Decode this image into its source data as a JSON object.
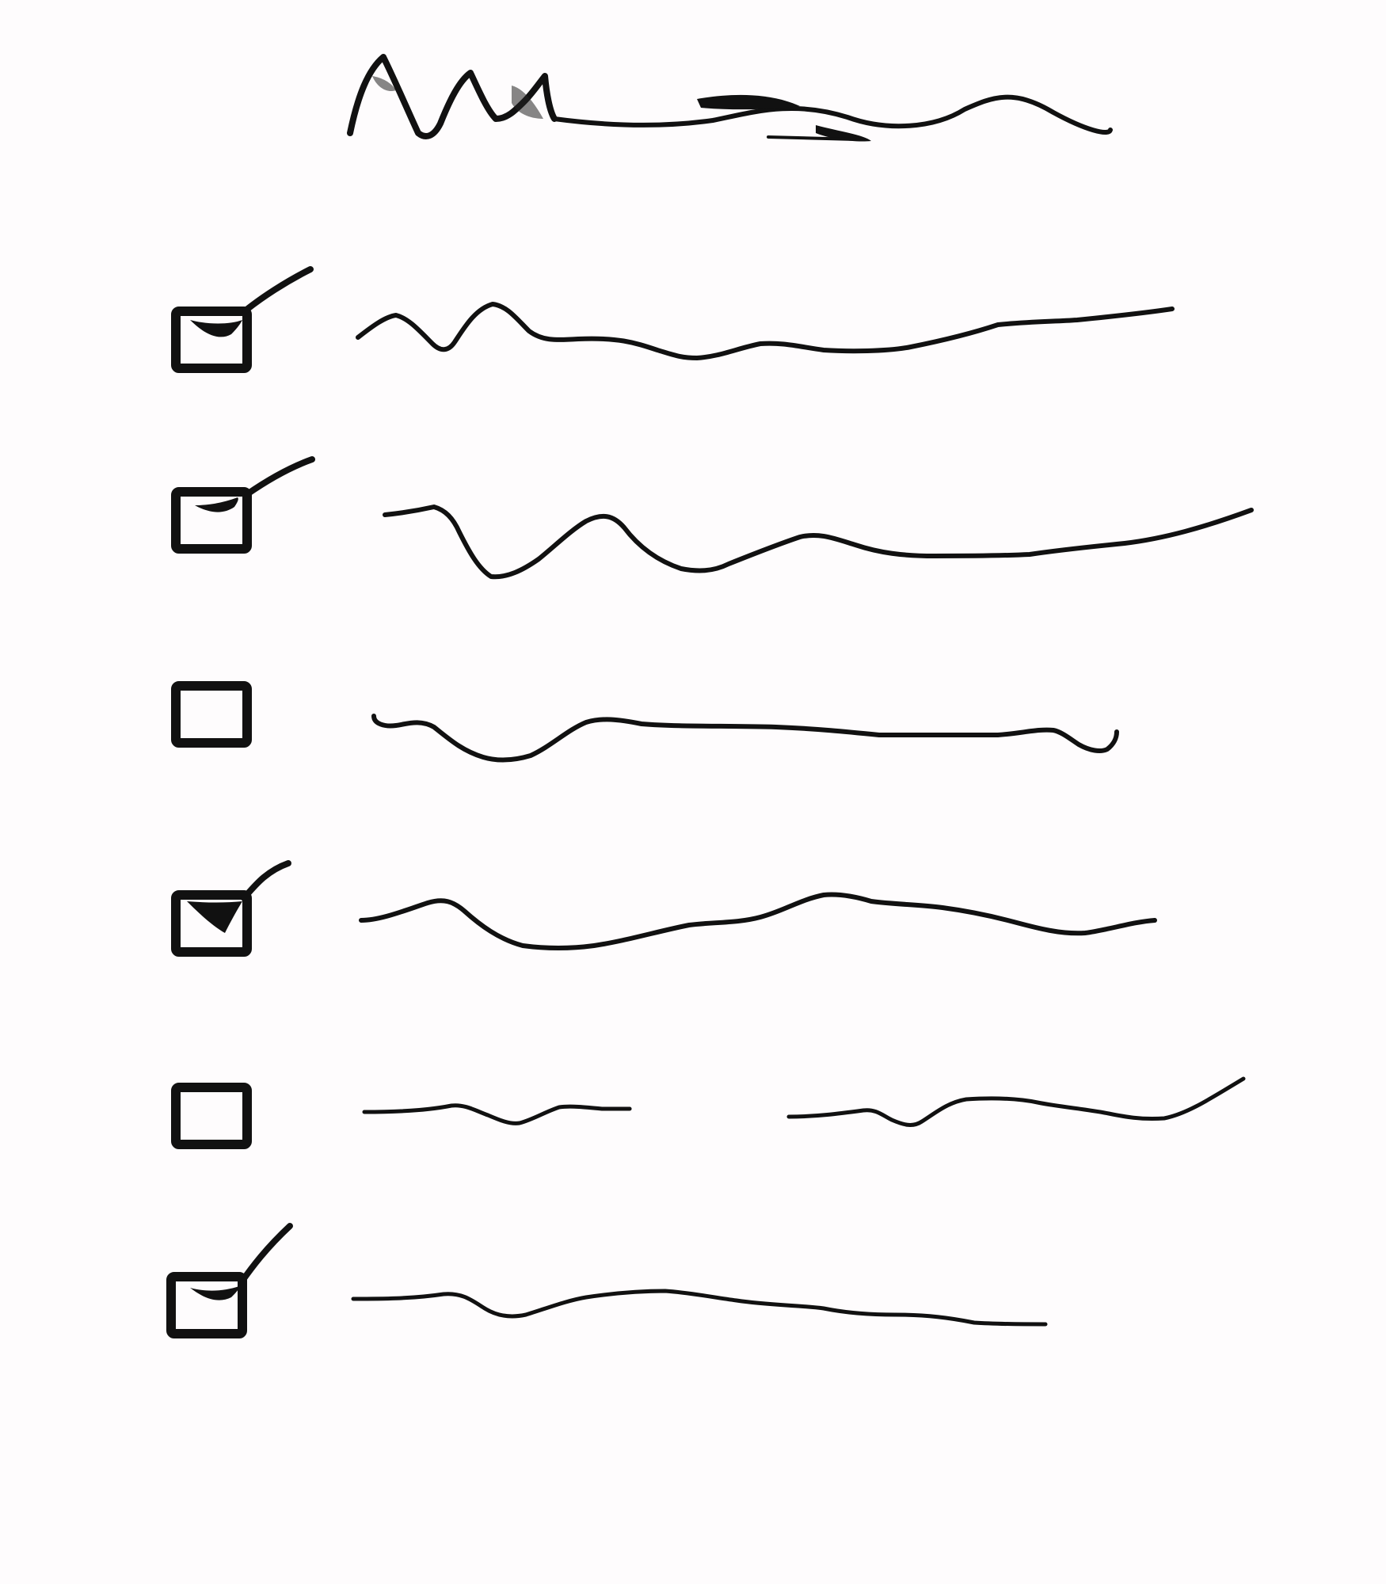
{
  "sketch": {
    "heading_scribble": "title-scribble",
    "items": [
      {
        "checked": true
      },
      {
        "checked": true
      },
      {
        "checked": false
      },
      {
        "checked": true
      },
      {
        "checked": false
      },
      {
        "checked": true
      }
    ],
    "colors": {
      "paper": "#fefcfd",
      "ink": "#111111"
    },
    "icons": {
      "checkbox": "hand-drawn-checkbox-icon",
      "check": "check-mark-icon"
    }
  }
}
